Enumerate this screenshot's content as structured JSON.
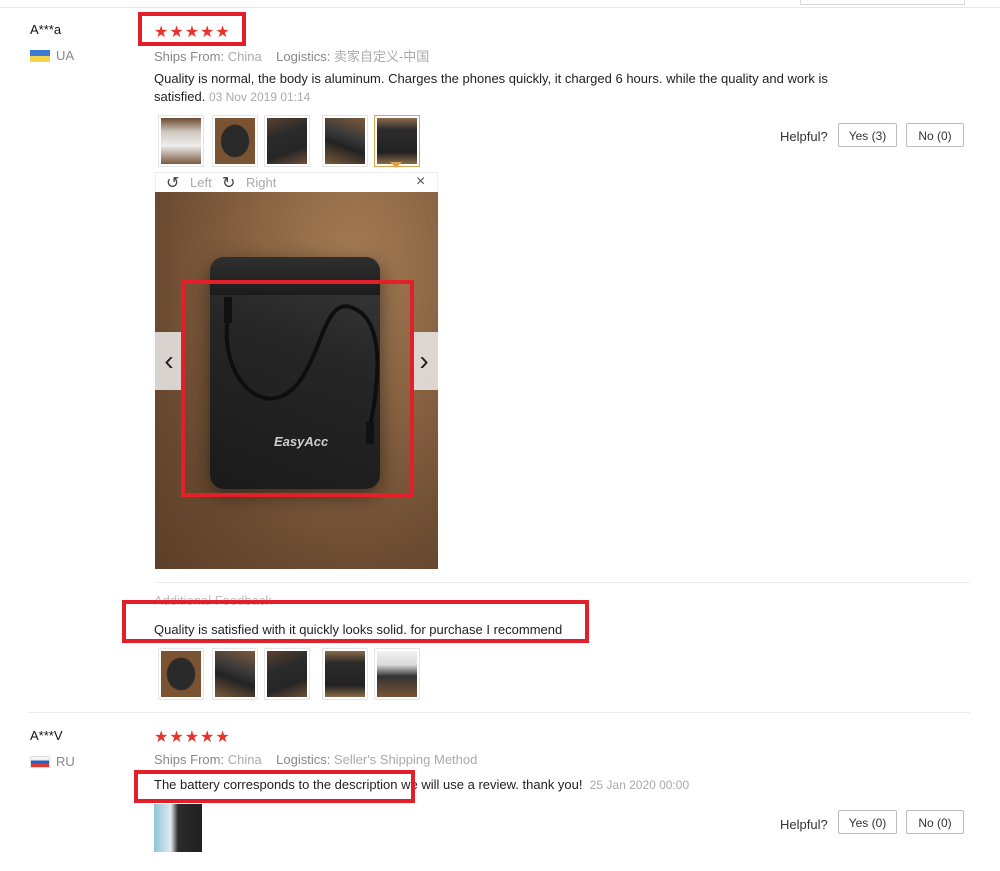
{
  "reviews": [
    {
      "name": "A***a",
      "country": "UA",
      "stars": "★★★★★",
      "ships_from_label": "Ships From:",
      "ships_from_value": "China",
      "logistics_label": "Logistics:",
      "logistics_value": "卖家自定义-中国",
      "text_line1": "Quality is normal, the body is aluminum. Charges the phones quickly, it charged 6 hours. while the quality and work is",
      "text_line2": "satisfied.",
      "date": "03 Nov 2019 01:14",
      "helpful_label": "Helpful?",
      "yes_label": "Yes (3)",
      "no_label": "No (0)",
      "viewer": {
        "left_label": "Left",
        "right_label": "Right",
        "close": "×",
        "prev": "‹",
        "next": "›",
        "brand": "EasyAcc"
      },
      "additional_label": "Additional Feedback",
      "additional_text": "Quality is satisfied with it quickly looks solid. for purchase I recommend"
    },
    {
      "name": "A***V",
      "country": "RU",
      "stars": "★★★★★",
      "ships_from_label": "Ships From:",
      "ships_from_value": "China",
      "logistics_label": "Logistics:",
      "logistics_value": "Seller's Shipping Method",
      "text": "The battery corresponds to the description we will use a review. thank you!",
      "date": "25 Jan 2020 00:00",
      "helpful_label": "Helpful?",
      "yes_label": "Yes (0)",
      "no_label": "No (0)"
    }
  ],
  "colors": {
    "star": "#e8342c",
    "highlight": "#e3202a",
    "selected_thumb": "#e1a14a"
  },
  "icons": {
    "rotate_left": "rotate-left-icon",
    "rotate_right": "rotate-right-icon",
    "close": "close-icon",
    "prev": "chevron-left-icon",
    "next": "chevron-right-icon"
  }
}
